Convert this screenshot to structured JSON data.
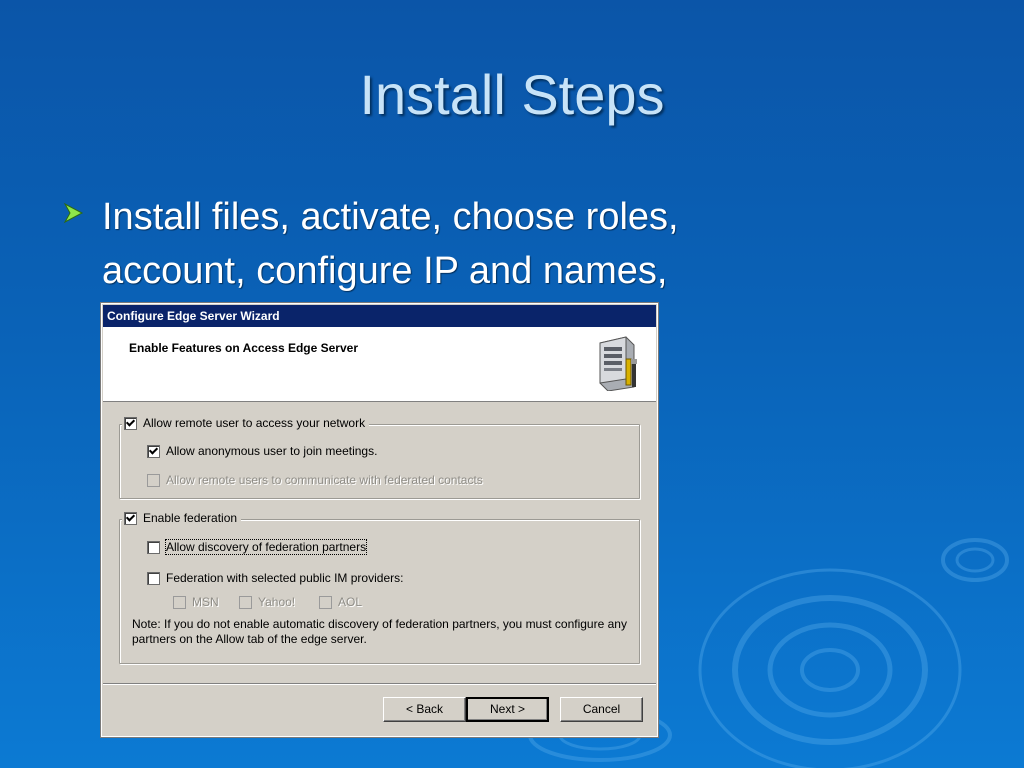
{
  "slide": {
    "title": "Install Steps",
    "bullet": "Install files, activate, choose roles, account, configure IP and names,"
  },
  "dialog": {
    "window_title": "Configure Edge Server Wizard",
    "header_title": "Enable Features on Access Edge Server",
    "remote_access": {
      "label": "Allow remote user to access your network",
      "checked": true,
      "options": [
        {
          "label": "Allow anonymous user to join meetings.",
          "checked": true,
          "enabled": true
        },
        {
          "label": "Allow remote users to communicate with federated contacts",
          "checked": false,
          "enabled": false
        }
      ]
    },
    "federation": {
      "label": "Enable federation",
      "checked": true,
      "discovery_label": "Allow discovery of federation partners",
      "public_im_label": "Federation with selected public IM providers:",
      "providers": [
        {
          "label": "MSN",
          "checked": false
        },
        {
          "label": "Yahoo!",
          "checked": false
        },
        {
          "label": "AOL",
          "checked": false
        }
      ],
      "note": "Note: If you do not enable automatic discovery of federation partners, you must configure any partners on the Allow tab of the edge server."
    },
    "buttons": {
      "back": "< Back",
      "next": "Next >",
      "cancel": "Cancel"
    }
  },
  "colors": {
    "background_top": "#0b55a8",
    "background_bottom": "#0c7ad3",
    "title_text": "#c7e3f8",
    "titlebar": "#0a246a",
    "dialog_face": "#d4d0c8"
  }
}
